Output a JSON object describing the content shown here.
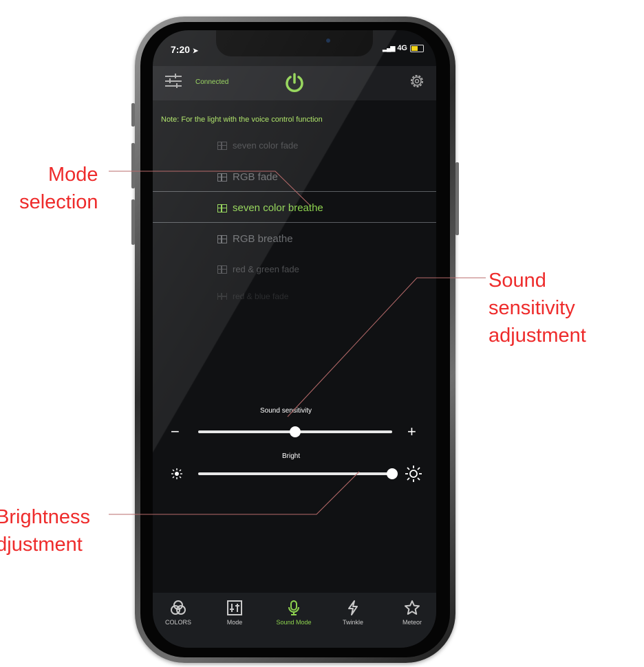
{
  "status_bar": {
    "time": "7:20",
    "network": "4G"
  },
  "header": {
    "connection_status": "Connected",
    "power_icon": "power-icon",
    "settings_icon": "gear-icon",
    "menu_icon": "sliders-menu-icon"
  },
  "note": "Note: For the light with the voice control function",
  "modes": {
    "items": [
      {
        "label": "seven color fade"
      },
      {
        "label": "RGB fade"
      },
      {
        "label": "seven color breathe",
        "selected": true
      },
      {
        "label": "RGB breathe"
      },
      {
        "label": "red & green fade"
      },
      {
        "label": "red & blue fade"
      }
    ]
  },
  "sound_sensitivity": {
    "label": "Sound sensitivity",
    "value": 0.5,
    "minus": "−",
    "plus": "+"
  },
  "brightness": {
    "label": "Bright",
    "value": 1.0
  },
  "tabs": [
    {
      "label": "COLORS",
      "icon": "color-circles-icon"
    },
    {
      "label": "Mode",
      "icon": "mode-sliders-icon"
    },
    {
      "label": "Sound Mode",
      "icon": "microphone-icon",
      "active": true
    },
    {
      "label": "Twinkle",
      "icon": "lightning-icon"
    },
    {
      "label": "Meteor",
      "icon": "star-icon"
    }
  ],
  "annotations": {
    "mode_selection": [
      "Mode",
      "selection"
    ],
    "sound_adjust": [
      "Sound",
      "sensitivity",
      "adjustment"
    ],
    "brightness_adjust": [
      "Brightness",
      "adjustment"
    ]
  },
  "colors": {
    "accent": "#8ed34f",
    "annotation": "#ee2b2b"
  }
}
